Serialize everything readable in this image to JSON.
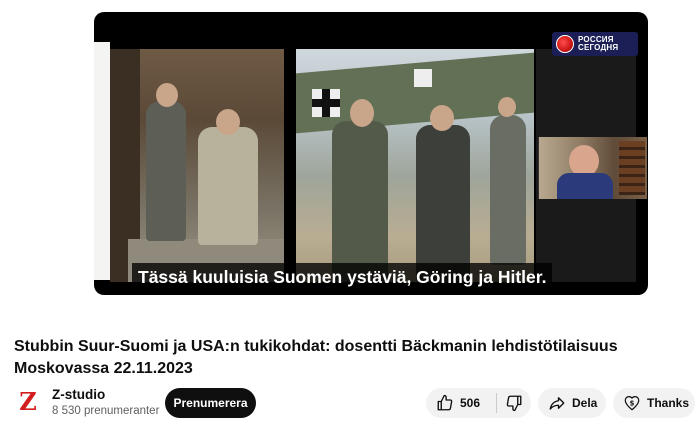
{
  "video": {
    "subtitle": "Tässä kuuluisia Suomen ystäviä, Göring ja Hitler.",
    "logo_text_line1": "РОССИЯ",
    "logo_text_line2": "СЕГОДНЯ"
  },
  "title": "Stubbin Suur-Suomi ja USA:n tukikohdat: dosentti Bäckmanin lehdistötilaisuus Moskovassa 22.11.2023",
  "channel": {
    "avatar_letter": "Z",
    "name": "Z-studio",
    "subscribers": "8 530 prenumeranter",
    "subscribe_label": "Prenumerera"
  },
  "actions": {
    "like_count": "506",
    "share_label": "Dela",
    "thanks_label": "Thanks"
  },
  "icons": [
    "thumbs-up-icon",
    "thumbs-down-icon",
    "share-icon",
    "thanks-icon"
  ],
  "colors": {
    "subscribe_bg": "#0f0f0f",
    "pill_bg": "#f2f2f2",
    "logo_bg": "#1b1f55",
    "avatar_accent": "#d21e1e"
  }
}
